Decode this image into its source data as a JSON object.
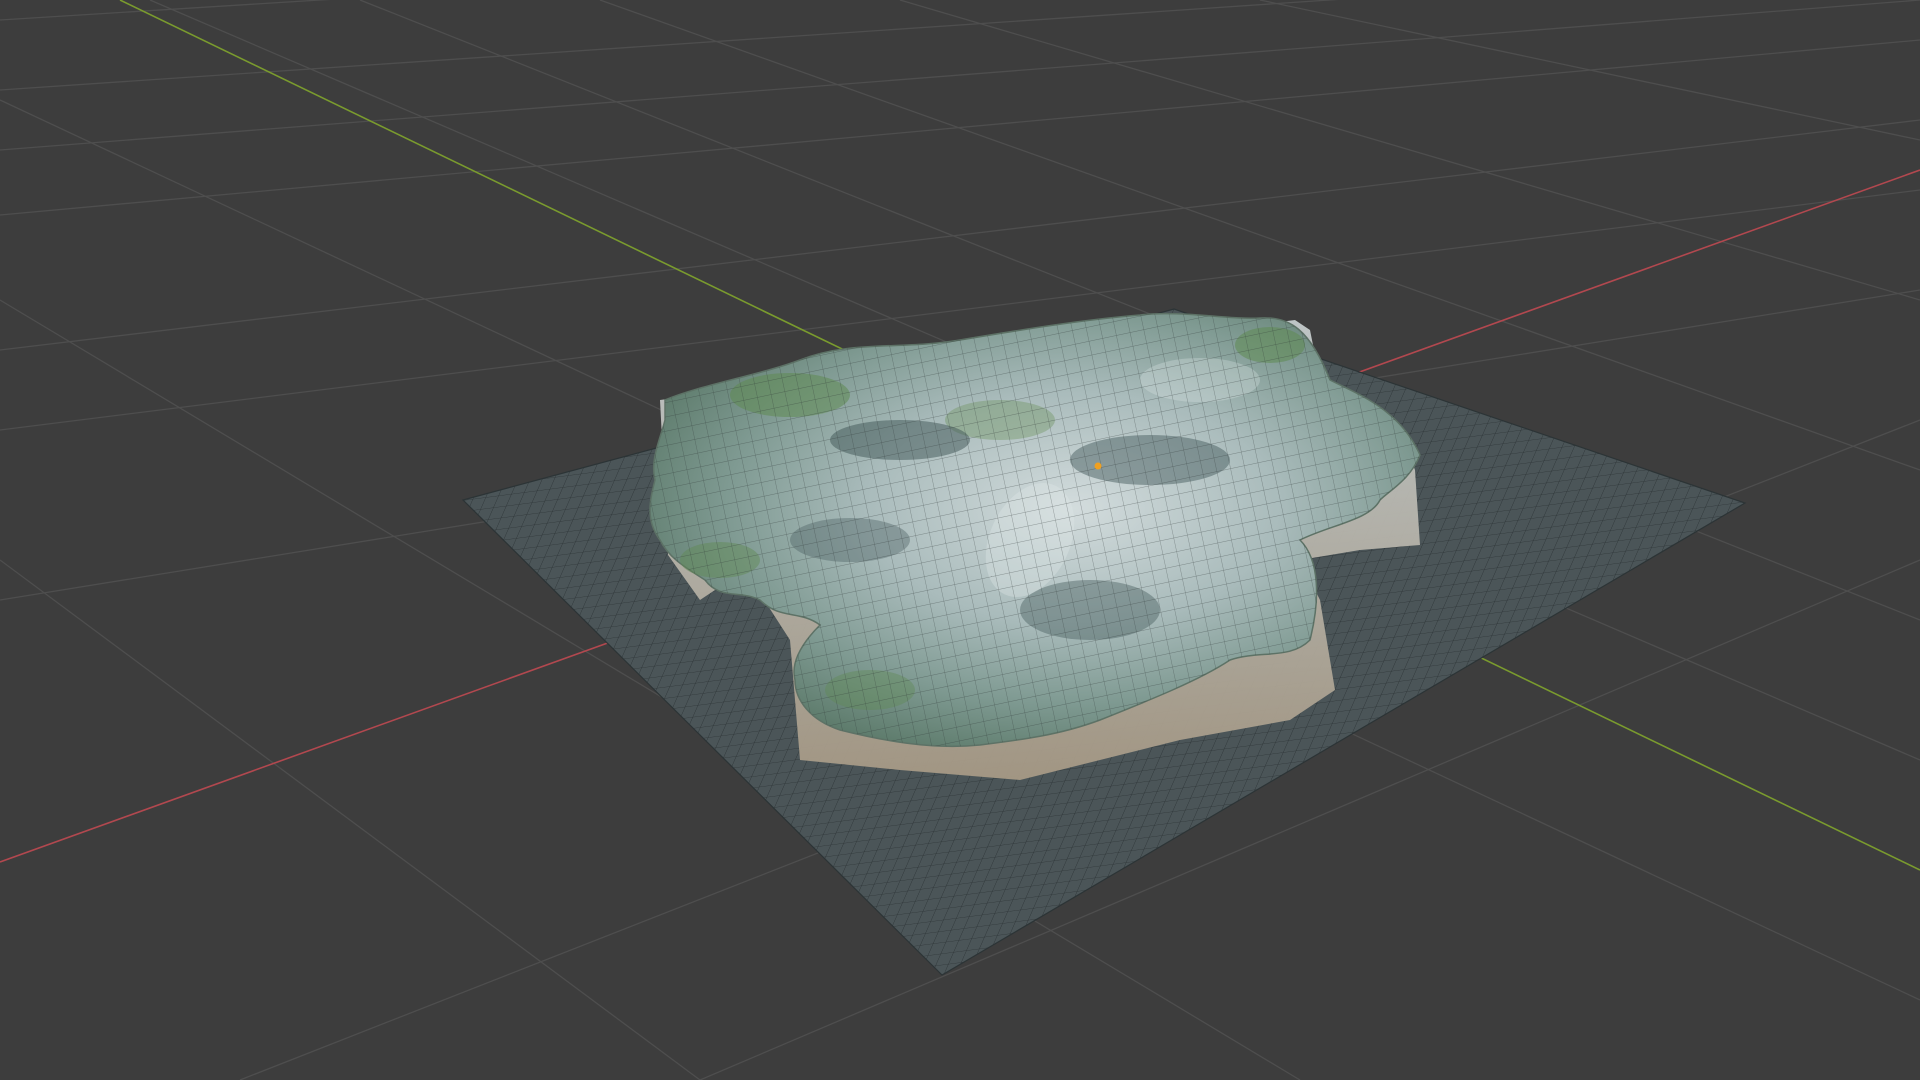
{
  "viewport": {
    "name": "3D Viewport",
    "background": "#3d3d3d",
    "grid_color": "#4e4e4e",
    "x_axis_color": "#b2484f",
    "y_axis_color": "#7a9b2e"
  },
  "scene": {
    "objects": [
      {
        "name": "ground-plane",
        "type": "mesh-plane",
        "display": "wireframe-on-shaded"
      },
      {
        "name": "terrain",
        "type": "displaced-mesh",
        "display": "wireframe-on-shaded"
      }
    ],
    "origin_marker_color": "#f0a020",
    "terrain_colors": {
      "rock_light": "#c9d4d6",
      "rock_mid": "#8fa5a6",
      "moss": "#5f8a52",
      "cliff_sand": "#a89b86",
      "shadow": "#3f5556"
    },
    "plane_color": "#4a5457"
  }
}
